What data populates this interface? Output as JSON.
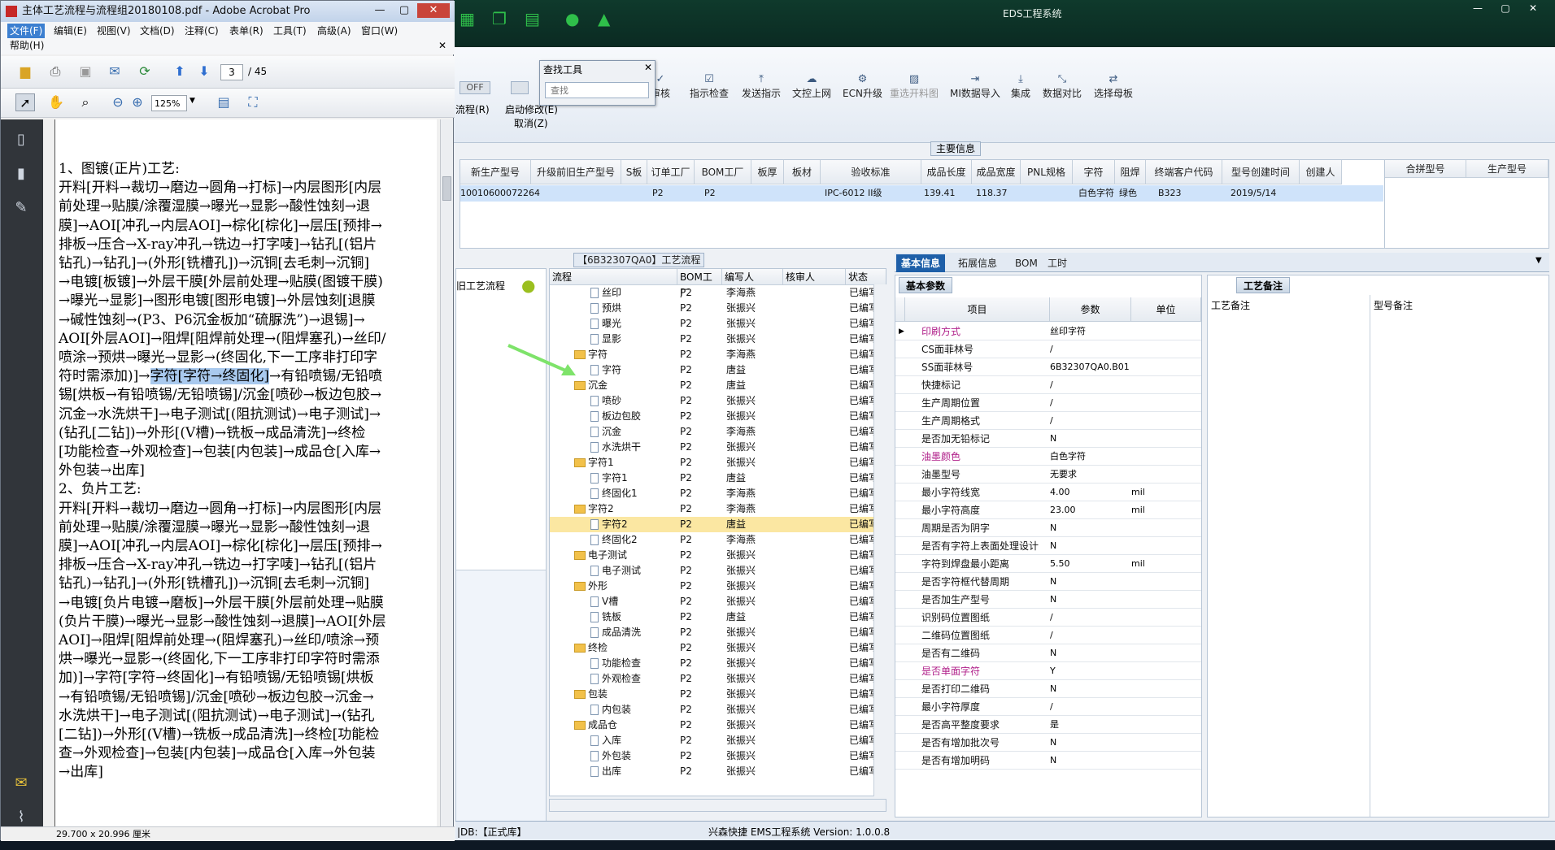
{
  "eds": {
    "title": "EDS工程系统",
    "ribbon": {
      "off_label": "OFF",
      "left_labels": [
        "流程(R)",
        "启动修改(E)",
        "取消(Z)"
      ],
      "buttons": [
        "审核",
        "指示检查",
        "发送指示",
        "文控上网",
        "ECN升级",
        "重选开料图",
        "MI数据导入",
        "集成",
        "数据对比",
        "选择母板"
      ]
    },
    "main_info_title": "主要信息",
    "grid_headers": [
      "新生产型号",
      "升级前旧生产型号",
      "S板",
      "订单工厂",
      "BOM工厂",
      "板厚",
      "板材",
      "验收标准",
      "成品长度",
      "成品宽度",
      "PNL规格",
      "字符",
      "阻焊",
      "终端客户代码",
      "型号创建时间",
      "创建人"
    ],
    "grid_row": [
      "10010600072264",
      "",
      "P2",
      "P2",
      "",
      "",
      "",
      "IPC-6012 II级",
      "139.41",
      "118.37",
      "",
      "白色字符",
      "绿色",
      "B323",
      "2019/5/14",
      ""
    ],
    "sub_headers": [
      "合拼型号",
      "生产型号"
    ],
    "process_title": "【6B32307QA0】工艺流程",
    "left_mini_label": "旧工艺流程",
    "tree_headers": [
      "流程",
      "BOM工厂",
      "编写人",
      "核审人",
      "状态"
    ],
    "tree_rows": [
      {
        "name": "丝印",
        "lvl": 2,
        "f": "P2",
        "w": "李海燕",
        "s": "已编写"
      },
      {
        "name": "预烘",
        "lvl": 2,
        "f": "P2",
        "w": "张振兴",
        "s": "已编写"
      },
      {
        "name": "曝光",
        "lvl": 2,
        "f": "P2",
        "w": "张振兴",
        "s": "已编写"
      },
      {
        "name": "显影",
        "lvl": 2,
        "f": "P2",
        "w": "张振兴",
        "s": "已编写"
      },
      {
        "name": "字符",
        "lvl": 1,
        "f": "P2",
        "w": "李海燕",
        "s": "已编写"
      },
      {
        "name": "字符",
        "lvl": 2,
        "f": "P2",
        "w": "唐益",
        "s": "已编写"
      },
      {
        "name": "沉金",
        "lvl": 1,
        "f": "P2",
        "w": "唐益",
        "s": "已编写"
      },
      {
        "name": "喷砂",
        "lvl": 2,
        "f": "P2",
        "w": "张振兴",
        "s": "已编写"
      },
      {
        "name": "板边包胶",
        "lvl": 2,
        "f": "P2",
        "w": "张振兴",
        "s": "已编写"
      },
      {
        "name": "沉金",
        "lvl": 2,
        "f": "P2",
        "w": "李海燕",
        "s": "已编写"
      },
      {
        "name": "水洗烘干",
        "lvl": 2,
        "f": "P2",
        "w": "张振兴",
        "s": "已编写"
      },
      {
        "name": "字符1",
        "lvl": 1,
        "f": "P2",
        "w": "张振兴",
        "s": "已编写"
      },
      {
        "name": "字符1",
        "lvl": 2,
        "f": "P2",
        "w": "唐益",
        "s": "已编写"
      },
      {
        "name": "终固化1",
        "lvl": 2,
        "f": "P2",
        "w": "李海燕",
        "s": "已编写"
      },
      {
        "name": "字符2",
        "lvl": 1,
        "f": "P2",
        "w": "李海燕",
        "s": "已编写"
      },
      {
        "name": "字符2",
        "lvl": 2,
        "f": "P2",
        "w": "唐益",
        "s": "已编写",
        "sel": true
      },
      {
        "name": "终固化2",
        "lvl": 2,
        "f": "P2",
        "w": "李海燕",
        "s": "已编写"
      },
      {
        "name": "电子测试",
        "lvl": 1,
        "f": "P2",
        "w": "张振兴",
        "s": "已编写"
      },
      {
        "name": "电子测试",
        "lvl": 2,
        "f": "P2",
        "w": "张振兴",
        "s": "已编写"
      },
      {
        "name": "外形",
        "lvl": 1,
        "f": "P2",
        "w": "张振兴",
        "s": "已编写"
      },
      {
        "name": "V槽",
        "lvl": 2,
        "f": "P2",
        "w": "张振兴",
        "s": "已编写"
      },
      {
        "name": "铣板",
        "lvl": 2,
        "f": "P2",
        "w": "唐益",
        "s": "已编写"
      },
      {
        "name": "成品清洗",
        "lvl": 2,
        "f": "P2",
        "w": "张振兴",
        "s": "已编写"
      },
      {
        "name": "终检",
        "lvl": 1,
        "f": "P2",
        "w": "张振兴",
        "s": "已编写"
      },
      {
        "name": "功能检查",
        "lvl": 2,
        "f": "P2",
        "w": "张振兴",
        "s": "已编写"
      },
      {
        "name": "外观检查",
        "lvl": 2,
        "f": "P2",
        "w": "张振兴",
        "s": "已编写"
      },
      {
        "name": "包装",
        "lvl": 1,
        "f": "P2",
        "w": "张振兴",
        "s": "已编写"
      },
      {
        "name": "内包装",
        "lvl": 2,
        "f": "P2",
        "w": "张振兴",
        "s": "已编写"
      },
      {
        "name": "成品仓",
        "lvl": 1,
        "f": "P2",
        "w": "张振兴",
        "s": "已编写"
      },
      {
        "name": "入库",
        "lvl": 2,
        "f": "P2",
        "w": "张振兴",
        "s": "已编写"
      },
      {
        "name": "外包装",
        "lvl": 2,
        "f": "P2",
        "w": "张振兴",
        "s": "已编写"
      },
      {
        "name": "出库",
        "lvl": 2,
        "f": "P2",
        "w": "张振兴",
        "s": "已编写"
      }
    ],
    "tabs": [
      "基本信息",
      "拓展信息",
      "BOM",
      "工时"
    ],
    "basic_params_title": "基本参数",
    "param_headers": [
      "项目",
      "参数",
      "单位"
    ],
    "params": [
      {
        "k": "印刷方式",
        "v": "丝印字符",
        "u": "",
        "mag": true
      },
      {
        "k": "CS面菲林号",
        "v": "/",
        "u": ""
      },
      {
        "k": "SS面菲林号",
        "v": "6B32307QA0.B01",
        "u": ""
      },
      {
        "k": "快捷标记",
        "v": "/",
        "u": ""
      },
      {
        "k": "生产周期位置",
        "v": "/",
        "u": ""
      },
      {
        "k": "生产周期格式",
        "v": "/",
        "u": ""
      },
      {
        "k": "是否加无铅标记",
        "v": "N",
        "u": ""
      },
      {
        "k": "油墨颜色",
        "v": "白色字符",
        "u": "",
        "mag": true
      },
      {
        "k": "油墨型号",
        "v": "无要求",
        "u": ""
      },
      {
        "k": "最小字符线宽",
        "v": "4.00",
        "u": "mil"
      },
      {
        "k": "最小字符高度",
        "v": "23.00",
        "u": "mil"
      },
      {
        "k": "周期是否为阴字",
        "v": "N",
        "u": ""
      },
      {
        "k": "是否有字符上表面处理设计",
        "v": "N",
        "u": ""
      },
      {
        "k": "字符到焊盘最小距离",
        "v": "5.50",
        "u": "mil"
      },
      {
        "k": "是否字符框代替周期",
        "v": "N",
        "u": ""
      },
      {
        "k": "是否加生产型号",
        "v": "N",
        "u": ""
      },
      {
        "k": "识别码位置图纸",
        "v": "/",
        "u": ""
      },
      {
        "k": "二维码位置图纸",
        "v": "/",
        "u": ""
      },
      {
        "k": "是否有二维码",
        "v": "N",
        "u": ""
      },
      {
        "k": "是否单面字符",
        "v": "Y",
        "u": "",
        "mag": true
      },
      {
        "k": "是否打印二维码",
        "v": "N",
        "u": ""
      },
      {
        "k": "最小字符厚度",
        "v": "/",
        "u": ""
      },
      {
        "k": "是否高平整度要求",
        "v": "是",
        "u": ""
      },
      {
        "k": "是否有增加批次号",
        "v": "N",
        "u": ""
      },
      {
        "k": "是否有增加明码",
        "v": "N",
        "u": ""
      }
    ],
    "notes_title": "工艺备注",
    "notes_cols": [
      "工艺备注",
      "型号备注"
    ],
    "status_db": "|DB:【正式库】",
    "status_version": "兴森快捷 EMS工程系统 Version: 1.0.0.8"
  },
  "search": {
    "title": "查找工具",
    "placeholder": "查找"
  },
  "acrobat": {
    "title": "主体工艺流程与流程组20180108.pdf - Adobe Acrobat Pro",
    "menu": [
      "文件(F)",
      "编辑(E)",
      "视图(V)",
      "文档(D)",
      "注释(C)",
      "表单(R)",
      "工具(T)",
      "高级(A)",
      "窗口(W)",
      "帮助(H)"
    ],
    "page_num": "3",
    "page_total": "/ 45",
    "zoom": "125%",
    "page_size": "29.700 x 20.996 厘米",
    "lines": [
      "1、图镀(正片)工艺:",
      "开料[开料→裁切→磨边→圆角→打标]→内层图形[内层",
      "前处理→贴膜/涂覆湿膜→曝光→显影→酸性蚀刻→退",
      "膜]→AOI[冲孔→内层AOI]→棕化[棕化]→层压[预排→",
      "排板→压合→X-ray冲孔→铣边→打字唛]→钻孔[(铝片",
      "钻孔)→钻孔]→(外形[铣槽孔])→沉铜[去毛刺→沉铜]",
      "→电镀[板镀]→外层干膜[外层前处理→贴膜(图镀干膜)",
      "→曝光→显影]→图形电镀[图形电镀]→外层蚀刻[退膜",
      "→碱性蚀刻→(P3、P6沉金板加“硫脲洗”)→退锡]→",
      "AOI[外层AOI]→阻焊[阻焊前处理→(阻焊塞孔)→丝印/",
      "喷涂→预烘→曝光→显影→(终固化,下一工序非打印字",
      "符时需添加)]→",
      "锡[烘板→有铅喷锡/无铅喷锡]/沉金[喷砂→板边包胶→",
      "沉金→水洗烘干]→电子测试[(阻抗测试)→电子测试]→",
      "(钻孔[二钻])→外形[(V槽)→铣板→成品清洗]→终检",
      "[功能检查→外观检查]→包装[内包装]→成品仓[入库→",
      "外包装→出库]",
      "2、负片工艺:",
      "开料[开料→裁切→磨边→圆角→打标]→内层图形[内层",
      "前处理→贴膜/涂覆湿膜→曝光→显影→酸性蚀刻→退",
      "膜]→AOI[冲孔→内层AOI]→棕化[棕化]→层压[预排→",
      "排板→压合→X-ray冲孔→铣边→打字唛]→钻孔[(铝片",
      "钻孔)→钻孔]→(外形[铣槽孔])→沉铜[去毛刺→沉铜]",
      "→电镀[负片电镀→磨板]→外层干膜[外层前处理→贴膜",
      "(负片干膜)→曝光→显影→酸性蚀刻→退膜]→AOI[外层",
      "AOI]→阻焊[阻焊前处理→(阻焊塞孔)→丝印/喷涂→预",
      "烘→曝光→显影→(终固化,下一工序非打印字符时需添",
      "加)]→字符[字符→终固化]→有铅喷锡/无铅喷锡[烘板",
      "→有铅喷锡/无铅喷锡]/沉金[喷砂→板边包胶→沉金→",
      "水洗烘干]→电子测试[(阻抗测试)→电子测试]→(钻孔",
      "[二钻])→外形[(V槽)→铣板→成品清洗]→终检[功能检",
      "查→外观检查]→包装[内包装]→成品仓[入库→外包装",
      "→出库]"
    ],
    "line12_highlight": "字符[字符→终固化]",
    "line12_tail": "→有铅喷锡/无铅喷"
  }
}
